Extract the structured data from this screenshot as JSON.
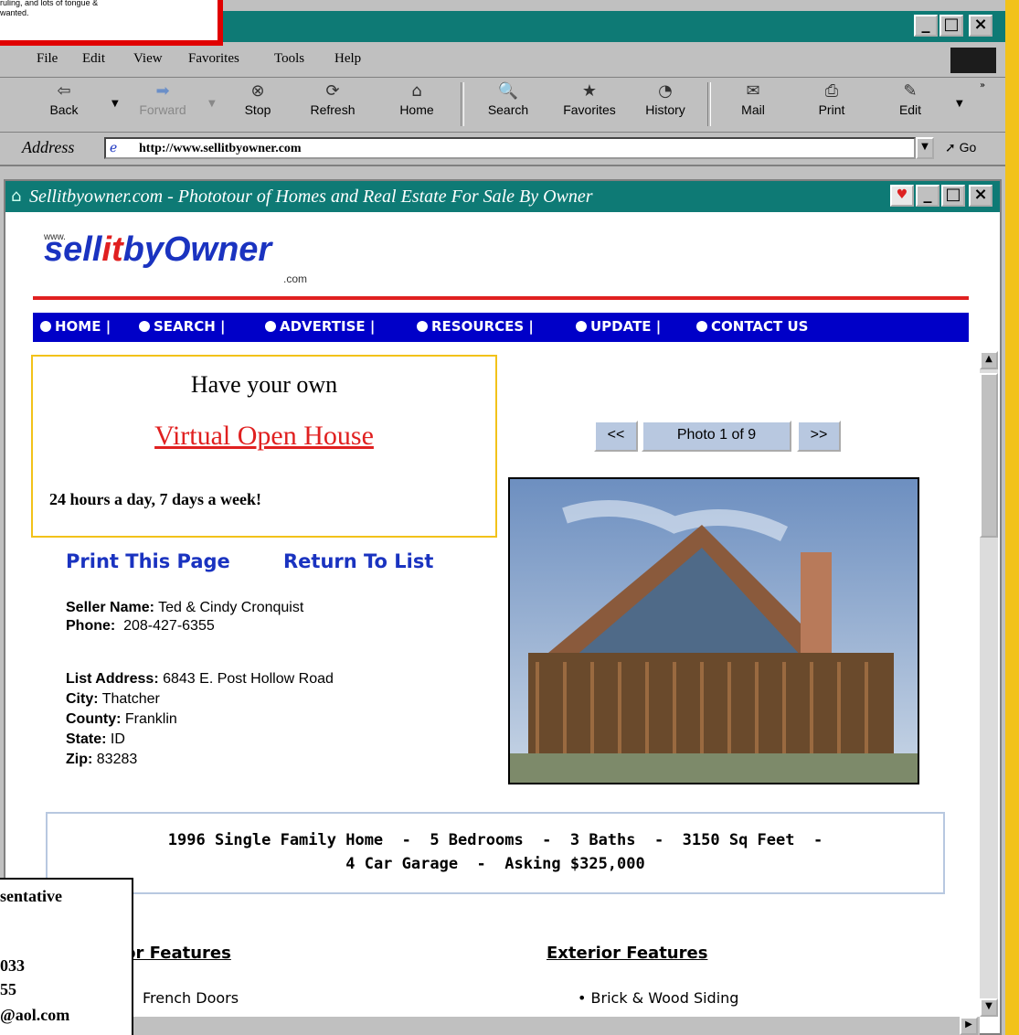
{
  "overlay_top": {
    "text": "ruling, and lots of tongue &\nwanted."
  },
  "rep_box": {
    "line1": "sentative",
    "line2": "033",
    "line3": "55",
    "line4": "@aol.com"
  },
  "ie_window": {
    "controls": {
      "min": "_",
      "max": "□",
      "close": "×"
    },
    "menu": [
      "File",
      "Edit",
      "View",
      "Favorites",
      "Tools",
      "Help"
    ],
    "toolbar": [
      {
        "label": "Back",
        "icon": "⇦"
      },
      {
        "label": "Forward",
        "icon": "➡"
      },
      {
        "label": "Stop",
        "icon": "⊗"
      },
      {
        "label": "Refresh",
        "icon": "⟳"
      },
      {
        "label": "Home",
        "icon": "⌂"
      },
      {
        "label": "Search",
        "icon": "🔍"
      },
      {
        "label": "Favorites",
        "icon": "★"
      },
      {
        "label": "History",
        "icon": "◔"
      },
      {
        "label": "Mail",
        "icon": "✉"
      },
      {
        "label": "Print",
        "icon": "⎙"
      },
      {
        "label": "Edit",
        "icon": "✎"
      }
    ],
    "address_label": "Address",
    "address_value": "http://www.sellitbyowner.com",
    "go_label": "Go"
  },
  "inner_window": {
    "title": "Sellitbyowner.com - Phototour of Homes and Real Estate For Sale By Owner"
  },
  "logo": {
    "www": "www.",
    "part1": "sell",
    "part2": "it",
    "part3": "byOwner",
    "com": ".com"
  },
  "nav": [
    "HOME |",
    "SEARCH |",
    "ADVERTISE |",
    "RESOURCES |",
    "UPDATE |",
    "CONTACT US"
  ],
  "promo": {
    "line1": "Have your own",
    "line2": "Virtual Open House",
    "line3": "24 hours a day, 7 days a week!"
  },
  "photo_nav": {
    "prev": "<<",
    "label": "Photo 1 of 9",
    "next": ">>"
  },
  "links": {
    "print": "Print This Page",
    "return": "Return To List"
  },
  "seller": {
    "name_label": "Seller Name:",
    "name": "Ted & Cindy Cronquist",
    "phone_label": "Phone:",
    "phone": "208-427-6355",
    "address_label": "List Address:",
    "address": "6843 E. Post Hollow Road",
    "city_label": "City:",
    "city": "Thatcher",
    "county_label": "County:",
    "county": "Franklin",
    "state_label": "State:",
    "state": "ID",
    "zip_label": "Zip:",
    "zip": "83283"
  },
  "summary": {
    "line1": "1996 Single Family Home  -  5 Bedrooms  -  3 Baths  -  3150 Sq Feet  -",
    "line2": "4 Car Garage  -  Asking $325,000"
  },
  "features": {
    "interior_heading": "ior Features",
    "interior_item": "French Doors",
    "exterior_heading": "Exterior Features",
    "exterior_item": "Brick & Wood Siding"
  },
  "colors": {
    "titlebar": "#0e7a75",
    "nav_bg": "#0000c8",
    "accent_red": "#e02020",
    "frame": "#f2c21a"
  }
}
